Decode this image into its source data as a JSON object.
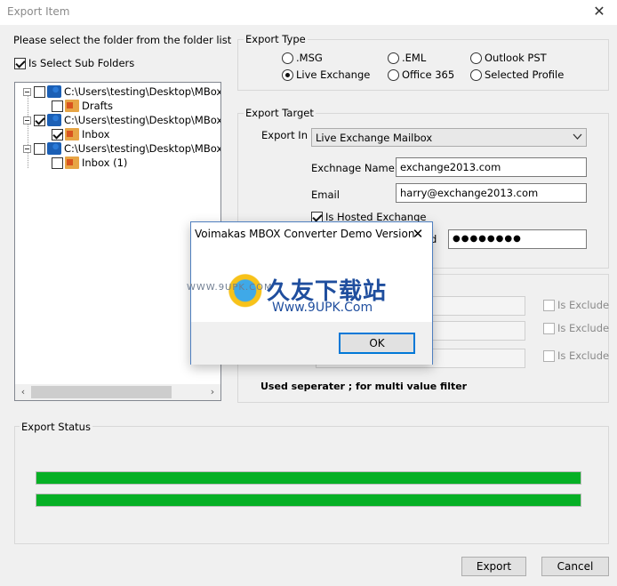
{
  "window": {
    "title": "Export Item",
    "close_glyph": "✕"
  },
  "folders": {
    "instruction": "Please select the folder from the folder list",
    "sub_folders_label": "Is Select Sub Folders",
    "sub_folders_checked": true,
    "tree": [
      {
        "label": "C:\\Users\\testing\\Desktop\\MBox Files\\",
        "checked": false,
        "child": {
          "label": "Drafts",
          "checked": false
        }
      },
      {
        "label": "C:\\Users\\testing\\Desktop\\MBox Files\\",
        "checked": true,
        "child": {
          "label": "Inbox",
          "checked": true
        }
      },
      {
        "label": "C:\\Users\\testing\\Desktop\\MBox Files\\",
        "checked": false,
        "child": {
          "label": "Inbox (1)",
          "checked": false
        }
      }
    ],
    "scroll_left": "‹",
    "scroll_right": "›"
  },
  "export_type": {
    "title": "Export Type",
    "options": [
      {
        "label": ".MSG",
        "checked": false
      },
      {
        "label": ".EML",
        "checked": false
      },
      {
        "label": "Outlook PST",
        "checked": false
      },
      {
        "label": "Live Exchange",
        "checked": true
      },
      {
        "label": "Office 365",
        "checked": false
      },
      {
        "label": "Selected Profile",
        "checked": false
      }
    ]
  },
  "export_target": {
    "title": "Export Target",
    "export_in_label": "Export In",
    "export_in_value": "Live Exchange Mailbox",
    "exchange_name_label": "Exchnage Name",
    "exchange_name_value": "exchange2013.com",
    "email_label": "Email",
    "email_value": "harry@exchange2013.com",
    "hosted_label": "Is Hosted Exchange",
    "hosted_checked": true,
    "password_label_fragment": "d",
    "password_value": "●●●●●●●●"
  },
  "filter": {
    "is_exclude_label": "Is Exclude",
    "separator_note": "Used seperater ; for multi value filter"
  },
  "status": {
    "title": "Export Status",
    "progress_1": 1.0,
    "progress_2": 1.0
  },
  "buttons": {
    "export": "Export",
    "cancel": "Cancel"
  },
  "modal": {
    "title": "Voimakas MBOX Converter Demo Version",
    "close_glyph": "✕",
    "ok": "OK"
  },
  "watermark": {
    "cn": "久友下载站",
    "url": "Www.9UPK.Com",
    "www": "WWW.9UPK.COM"
  },
  "colors": {
    "progress": "#06b025",
    "accent": "#0078d7"
  }
}
